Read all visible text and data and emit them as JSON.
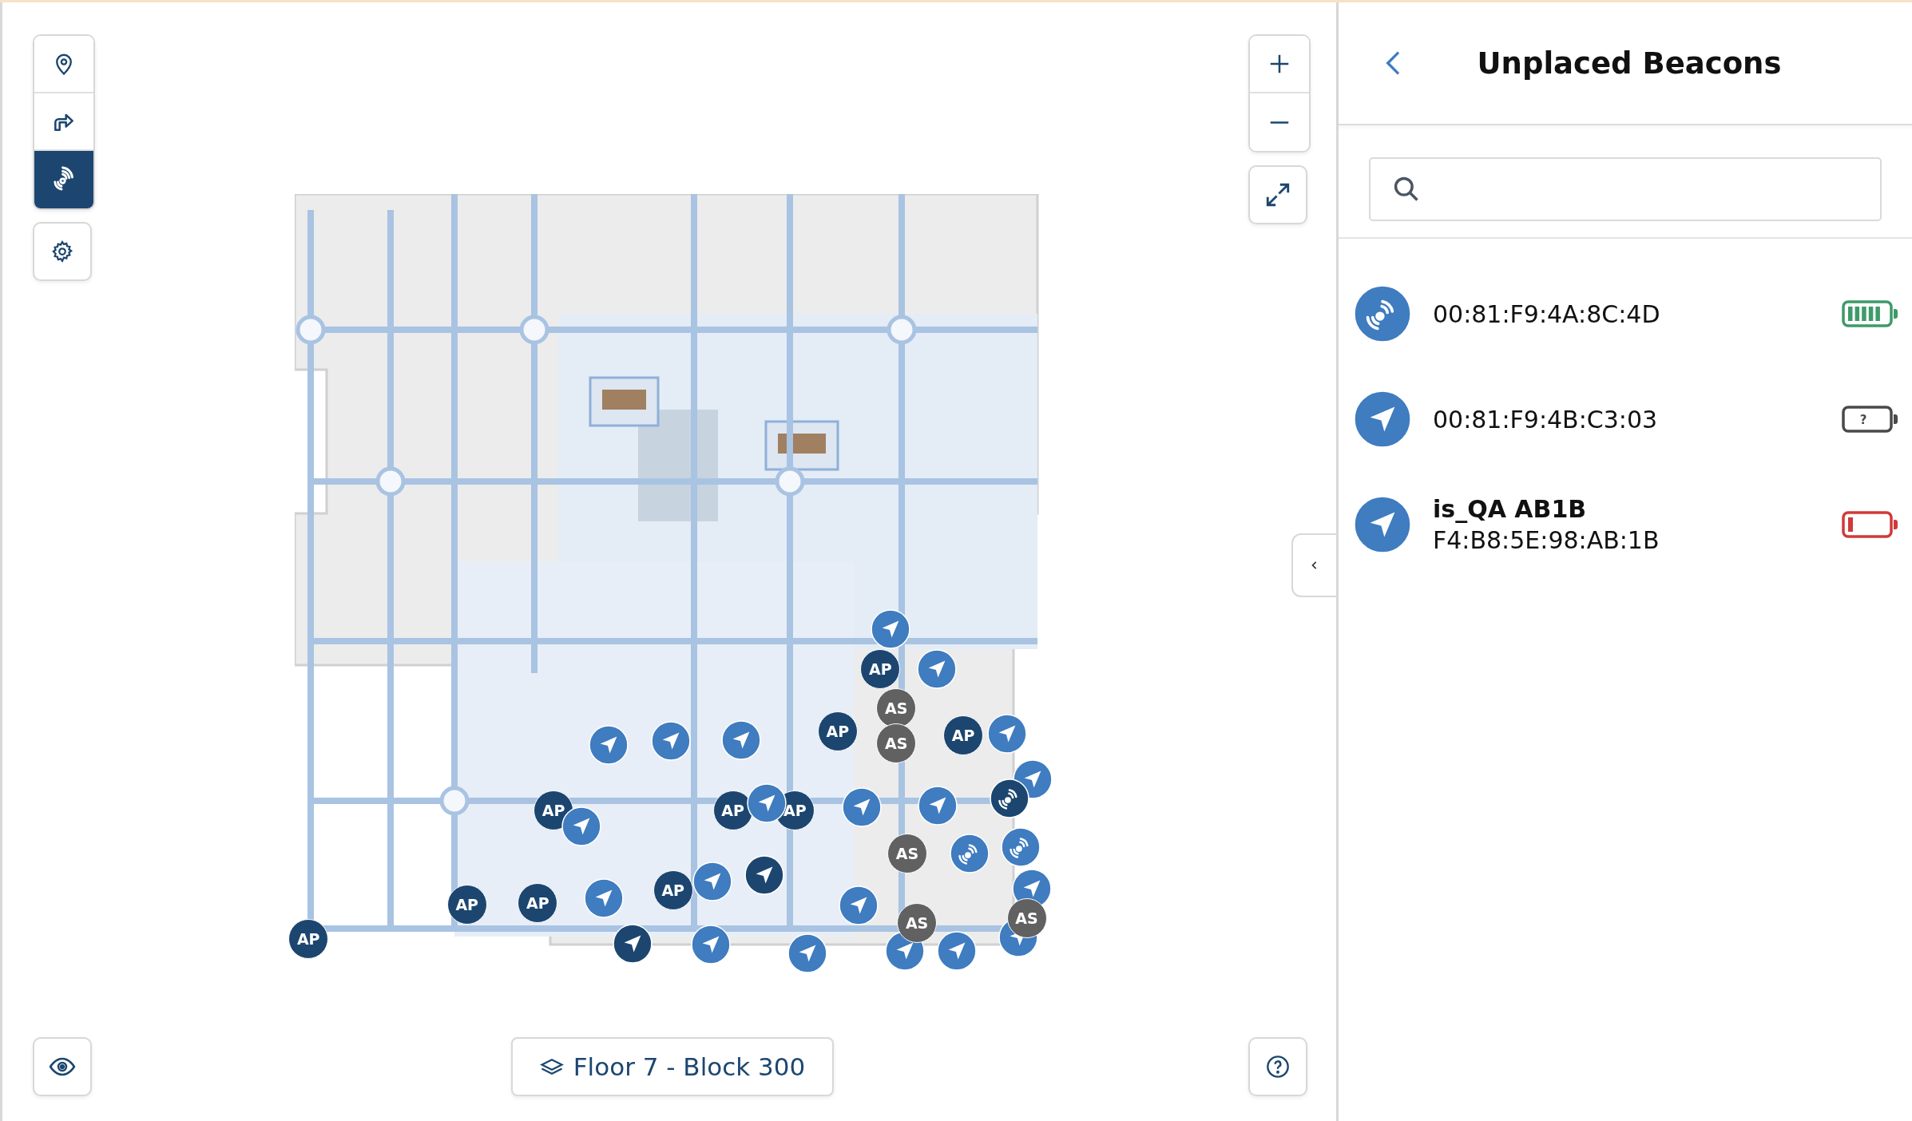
{
  "map_tools": [
    {
      "kind": "pin",
      "selected": false
    },
    {
      "kind": "route",
      "selected": false
    },
    {
      "kind": "signal",
      "selected": true
    }
  ],
  "markers": [
    {
      "kind": "ap",
      "label": "AP"
    },
    {
      "kind": "ap",
      "label": "AP"
    },
    {
      "kind": "ap",
      "label": "AP"
    },
    {
      "kind": "ap",
      "label": "AP"
    },
    {
      "kind": "ap",
      "label": "AP"
    },
    {
      "kind": "ap",
      "label": "AP"
    },
    {
      "kind": "ap",
      "label": "AP"
    },
    {
      "kind": "ap",
      "label": "AP"
    },
    {
      "kind": "ap",
      "label": "AP"
    },
    {
      "kind": "ap",
      "label": "AP"
    },
    {
      "kind": "as",
      "label": "AS"
    },
    {
      "kind": "as",
      "label": "AS"
    },
    {
      "kind": "as",
      "label": "AS"
    },
    {
      "kind": "as",
      "label": "AS"
    },
    {
      "kind": "as",
      "label": "AS"
    },
    {
      "kind": "arrow"
    },
    {
      "kind": "arrow"
    },
    {
      "kind": "arrow"
    },
    {
      "kind": "arrow"
    },
    {
      "kind": "arrow"
    },
    {
      "kind": "arrow"
    },
    {
      "kind": "arrow"
    },
    {
      "kind": "arrow"
    },
    {
      "kind": "arrow"
    },
    {
      "kind": "arrow"
    },
    {
      "kind": "arrow"
    },
    {
      "kind": "arrow"
    },
    {
      "kind": "arrow"
    },
    {
      "kind": "arrow"
    },
    {
      "kind": "arrow"
    },
    {
      "kind": "arrow"
    },
    {
      "kind": "arrow"
    },
    {
      "kind": "arrow"
    },
    {
      "kind": "arrow"
    },
    {
      "kind": "arrow"
    },
    {
      "kind": "arrow_dark"
    },
    {
      "kind": "arrow_dark"
    },
    {
      "kind": "signal"
    },
    {
      "kind": "signal_dark"
    },
    {
      "kind": "signal"
    }
  ],
  "floor_selector": {
    "label": "Floor 7 - Block 300"
  },
  "panel": {
    "title": "Unplaced Beacons",
    "beacons": [
      {
        "kind": "signal",
        "address": "00:81:F9:4A:8C:4D",
        "battery": {
          "kind": "full"
        }
      },
      {
        "kind": "arrow",
        "address": "00:81:F9:4B:C3:03",
        "battery": {
          "kind": "unknown",
          "mark": "?"
        }
      },
      {
        "kind": "arrow",
        "name": "is_QA AB1B",
        "address": "F4:B8:5E:98:AB:1B",
        "battery": {
          "kind": "low"
        }
      }
    ]
  }
}
